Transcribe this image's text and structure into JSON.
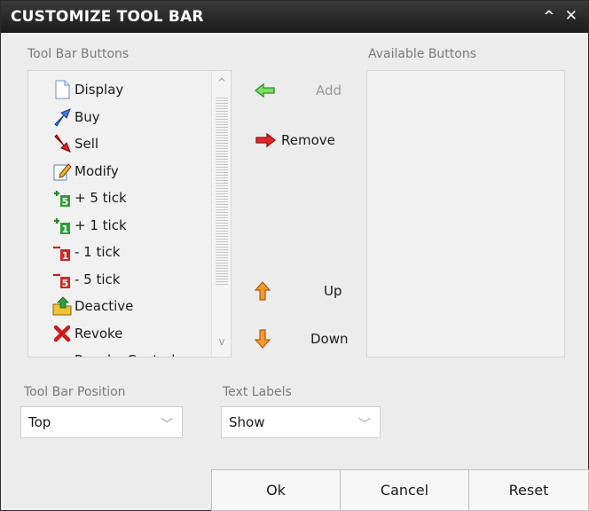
{
  "dialog": {
    "title": "CUSTOMIZE TOOL BAR",
    "collapse_glyph": "^",
    "close_glyph": "✕"
  },
  "toolbar_buttons": {
    "label": "Tool Bar Buttons",
    "items": [
      {
        "label": "Display",
        "icon": "document-icon"
      },
      {
        "label": "Buy",
        "icon": "buy-arrow-icon"
      },
      {
        "label": "Sell",
        "icon": "sell-arrow-icon"
      },
      {
        "label": "Modify",
        "icon": "modify-icon"
      },
      {
        "label": "+ 5 tick",
        "icon": "plus-5-tick-icon"
      },
      {
        "label": "+ 1 tick",
        "icon": "plus-1-tick-icon"
      },
      {
        "label": "- 1 tick",
        "icon": "minus-1-tick-icon"
      },
      {
        "label": "- 5 tick",
        "icon": "minus-5-tick-icon"
      },
      {
        "label": "Deactive",
        "icon": "deactive-icon"
      },
      {
        "label": "Revoke",
        "icon": "revoke-icon"
      },
      {
        "label": "Revoke Control",
        "icon": "revoke-control-icon"
      }
    ],
    "scroll_up_glyph": "^",
    "scroll_down_glyph": "v"
  },
  "actions": {
    "add": "Add",
    "remove": "Remove",
    "up": "Up",
    "down": "Down"
  },
  "available_buttons": {
    "label": "Available Buttons",
    "items": []
  },
  "toolbar_position": {
    "label": "Tool Bar Position",
    "value": "Top"
  },
  "text_labels": {
    "label": "Text Labels",
    "value": "Show"
  },
  "footer": {
    "ok": "Ok",
    "cancel": "Cancel",
    "reset": "Reset"
  },
  "colors": {
    "titlebar": "#1b1b1b",
    "add_arrow": "#3cb043",
    "remove_arrow": "#d62020",
    "up_down_arrow": "#f08a1c"
  }
}
